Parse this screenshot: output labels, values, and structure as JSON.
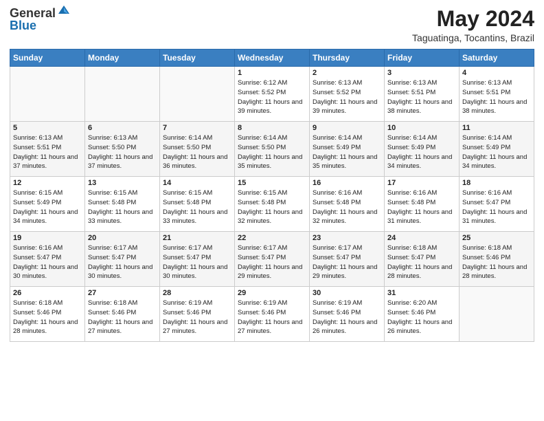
{
  "header": {
    "logo_general": "General",
    "logo_blue": "Blue",
    "month_year": "May 2024",
    "location": "Taguatinga, Tocantins, Brazil"
  },
  "weekdays": [
    "Sunday",
    "Monday",
    "Tuesday",
    "Wednesday",
    "Thursday",
    "Friday",
    "Saturday"
  ],
  "weeks": [
    [
      {
        "day": "",
        "info": ""
      },
      {
        "day": "",
        "info": ""
      },
      {
        "day": "",
        "info": ""
      },
      {
        "day": "1",
        "info": "Sunrise: 6:12 AM\nSunset: 5:52 PM\nDaylight: 11 hours and 39 minutes."
      },
      {
        "day": "2",
        "info": "Sunrise: 6:13 AM\nSunset: 5:52 PM\nDaylight: 11 hours and 39 minutes."
      },
      {
        "day": "3",
        "info": "Sunrise: 6:13 AM\nSunset: 5:51 PM\nDaylight: 11 hours and 38 minutes."
      },
      {
        "day": "4",
        "info": "Sunrise: 6:13 AM\nSunset: 5:51 PM\nDaylight: 11 hours and 38 minutes."
      }
    ],
    [
      {
        "day": "5",
        "info": "Sunrise: 6:13 AM\nSunset: 5:51 PM\nDaylight: 11 hours and 37 minutes."
      },
      {
        "day": "6",
        "info": "Sunrise: 6:13 AM\nSunset: 5:50 PM\nDaylight: 11 hours and 37 minutes."
      },
      {
        "day": "7",
        "info": "Sunrise: 6:14 AM\nSunset: 5:50 PM\nDaylight: 11 hours and 36 minutes."
      },
      {
        "day": "8",
        "info": "Sunrise: 6:14 AM\nSunset: 5:50 PM\nDaylight: 11 hours and 35 minutes."
      },
      {
        "day": "9",
        "info": "Sunrise: 6:14 AM\nSunset: 5:49 PM\nDaylight: 11 hours and 35 minutes."
      },
      {
        "day": "10",
        "info": "Sunrise: 6:14 AM\nSunset: 5:49 PM\nDaylight: 11 hours and 34 minutes."
      },
      {
        "day": "11",
        "info": "Sunrise: 6:14 AM\nSunset: 5:49 PM\nDaylight: 11 hours and 34 minutes."
      }
    ],
    [
      {
        "day": "12",
        "info": "Sunrise: 6:15 AM\nSunset: 5:49 PM\nDaylight: 11 hours and 34 minutes."
      },
      {
        "day": "13",
        "info": "Sunrise: 6:15 AM\nSunset: 5:48 PM\nDaylight: 11 hours and 33 minutes."
      },
      {
        "day": "14",
        "info": "Sunrise: 6:15 AM\nSunset: 5:48 PM\nDaylight: 11 hours and 33 minutes."
      },
      {
        "day": "15",
        "info": "Sunrise: 6:15 AM\nSunset: 5:48 PM\nDaylight: 11 hours and 32 minutes."
      },
      {
        "day": "16",
        "info": "Sunrise: 6:16 AM\nSunset: 5:48 PM\nDaylight: 11 hours and 32 minutes."
      },
      {
        "day": "17",
        "info": "Sunrise: 6:16 AM\nSunset: 5:48 PM\nDaylight: 11 hours and 31 minutes."
      },
      {
        "day": "18",
        "info": "Sunrise: 6:16 AM\nSunset: 5:47 PM\nDaylight: 11 hours and 31 minutes."
      }
    ],
    [
      {
        "day": "19",
        "info": "Sunrise: 6:16 AM\nSunset: 5:47 PM\nDaylight: 11 hours and 30 minutes."
      },
      {
        "day": "20",
        "info": "Sunrise: 6:17 AM\nSunset: 5:47 PM\nDaylight: 11 hours and 30 minutes."
      },
      {
        "day": "21",
        "info": "Sunrise: 6:17 AM\nSunset: 5:47 PM\nDaylight: 11 hours and 30 minutes."
      },
      {
        "day": "22",
        "info": "Sunrise: 6:17 AM\nSunset: 5:47 PM\nDaylight: 11 hours and 29 minutes."
      },
      {
        "day": "23",
        "info": "Sunrise: 6:17 AM\nSunset: 5:47 PM\nDaylight: 11 hours and 29 minutes."
      },
      {
        "day": "24",
        "info": "Sunrise: 6:18 AM\nSunset: 5:47 PM\nDaylight: 11 hours and 28 minutes."
      },
      {
        "day": "25",
        "info": "Sunrise: 6:18 AM\nSunset: 5:46 PM\nDaylight: 11 hours and 28 minutes."
      }
    ],
    [
      {
        "day": "26",
        "info": "Sunrise: 6:18 AM\nSunset: 5:46 PM\nDaylight: 11 hours and 28 minutes."
      },
      {
        "day": "27",
        "info": "Sunrise: 6:18 AM\nSunset: 5:46 PM\nDaylight: 11 hours and 27 minutes."
      },
      {
        "day": "28",
        "info": "Sunrise: 6:19 AM\nSunset: 5:46 PM\nDaylight: 11 hours and 27 minutes."
      },
      {
        "day": "29",
        "info": "Sunrise: 6:19 AM\nSunset: 5:46 PM\nDaylight: 11 hours and 27 minutes."
      },
      {
        "day": "30",
        "info": "Sunrise: 6:19 AM\nSunset: 5:46 PM\nDaylight: 11 hours and 26 minutes."
      },
      {
        "day": "31",
        "info": "Sunrise: 6:20 AM\nSunset: 5:46 PM\nDaylight: 11 hours and 26 minutes."
      },
      {
        "day": "",
        "info": ""
      }
    ]
  ]
}
